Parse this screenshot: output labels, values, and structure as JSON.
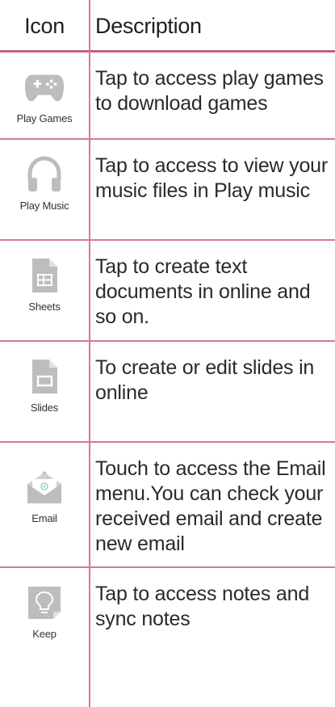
{
  "header": {
    "icon_col": "Icon",
    "desc_col": "Description"
  },
  "rows": [
    {
      "label": "Play Games",
      "icon": "game-controller-icon",
      "description": "Tap to access play games to download games"
    },
    {
      "label": "Play Music",
      "icon": "headphones-icon",
      "description": "Tap to access to view your music files in Play music"
    },
    {
      "label": "Sheets",
      "icon": "sheets-document-icon",
      "description": "Tap to create text documents in online and so on."
    },
    {
      "label": "Slides",
      "icon": "slides-document-icon",
      "description": "To create or edit slides in online"
    },
    {
      "label": "Email",
      "icon": "email-envelope-icon",
      "description": "Touch to access the Email menu.You can check your received email and create new email"
    },
    {
      "label": "Keep",
      "icon": "lightbulb-note-icon",
      "description": "Tap to access notes and sync notes"
    }
  ],
  "colors": {
    "rule": "#d57a93",
    "icon_gray": "#bdbdbd"
  }
}
